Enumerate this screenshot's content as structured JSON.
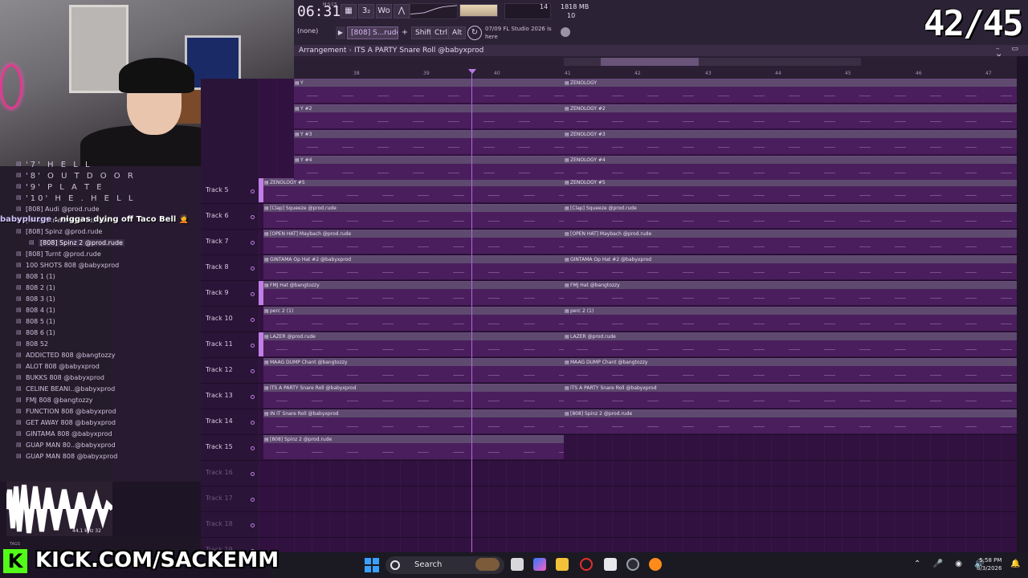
{
  "toolbar": {
    "time": "06:31",
    "time_sub": "M:S:CS",
    "buttons": [
      "▦",
      "3₂",
      "Wo",
      "⋀"
    ],
    "cpu": "14",
    "ram": "1818 MB",
    "polyphony": "10",
    "pattern": "(none)",
    "sample": "[808] S...rude",
    "plus": "+",
    "keys": [
      "Shift",
      "Ctrl",
      "Alt"
    ],
    "news_line1": "07/09  FL Studio 2026 is",
    "news_line2": "here",
    "counter": "42/45"
  },
  "arrangement": {
    "breadcrumb_a": "Arrangement",
    "breadcrumb_sep": "›",
    "breadcrumb_b": "ITS A PARTY Snare Roll @babyxprod",
    "window_controls": "– ▭ ✕",
    "bar_numbers": [
      "38",
      "39",
      "40",
      "41",
      "42",
      "43",
      "44",
      "45",
      "46",
      "47"
    ],
    "upper_clips": [
      "Y",
      "ZENOLOGY",
      "Y #2",
      "ZENOLOGY #2",
      "Y #3",
      "ZENOLOGY #3",
      "Y #4",
      "ZENOLOGY #4"
    ],
    "tracks": [
      {
        "name": "Track 5",
        "clip_a": "ZENOLOGY #5",
        "clip_b": "ZENOLOGY #5"
      },
      {
        "name": "Track 6",
        "clip_a": "[Clap] Squeeze @prod.rude",
        "clip_b": "[Clap] Squeeze @prod.rude"
      },
      {
        "name": "Track 7",
        "clip_a": "[OPEN HAT] Maybach @prod.rude",
        "clip_b": "[OPEN HAT] Maybach @prod.rude"
      },
      {
        "name": "Track 8",
        "clip_a": "GINTAMA Op Hat #2 @babyxprod",
        "clip_b": "GINTAMA Op Hat #2 @babyxprod"
      },
      {
        "name": "Track 9",
        "clip_a": "FMJ Hat @bangtozzy",
        "clip_b": "FMJ Hat @bangtozzy"
      },
      {
        "name": "Track 10",
        "clip_a": "perc 2 (1)",
        "clip_b": "perc 2 (1)"
      },
      {
        "name": "Track 11",
        "clip_a": "LAZER @prod.rude",
        "clip_b": "LAZER @prod.rude"
      },
      {
        "name": "Track 12",
        "clip_a": "MAAG DUMP Chant @bangtozzy",
        "clip_b": "MAAG DUMP Chant @bangtozzy"
      },
      {
        "name": "Track 13",
        "clip_a": "ITS A PARTY Snare Roll @babyxprod",
        "clip_b": "ITS A PARTY Snare Roll @babyxprod"
      },
      {
        "name": "Track 14",
        "clip_a": "IN IT Snare Roll @babyxprod",
        "clip_b": "[808] Spinz 2 @prod.rude"
      },
      {
        "name": "Track 15",
        "clip_a": "[808] Spinz 2 @prod.rude",
        "clip_b": ""
      },
      {
        "name": "Track 16",
        "clip_a": "",
        "clip_b": ""
      },
      {
        "name": "Track 17",
        "clip_a": "",
        "clip_b": ""
      },
      {
        "name": "Track 18",
        "clip_a": "",
        "clip_b": ""
      },
      {
        "name": "Track 19",
        "clip_a": "",
        "clip_b": ""
      }
    ]
  },
  "browser": {
    "items": [
      {
        "label": "'7' H E L L",
        "style": "spaced"
      },
      {
        "label": "'8' O U T D O O R",
        "style": "spaced"
      },
      {
        "label": "'9' P L A T E",
        "style": "spaced"
      },
      {
        "label": "'10' H E . H E L L",
        "style": "spaced"
      },
      {
        "label": "[808] Audi @prod.rude",
        "style": ""
      },
      {
        "label": "[808] Scratch @prod.rude",
        "style": ""
      },
      {
        "label": "[808] Spinz @prod.rude",
        "style": ""
      },
      {
        "label": "[808] Spinz 2 @prod.rude",
        "style": "sel"
      },
      {
        "label": "[808] Turnt @prod.rude",
        "style": ""
      },
      {
        "label": "100 SHOTS 808 @babyxprod",
        "style": ""
      },
      {
        "label": "808 1 (1)",
        "style": ""
      },
      {
        "label": "808 2 (1)",
        "style": ""
      },
      {
        "label": "808 3 (1)",
        "style": ""
      },
      {
        "label": "808 4 (1)",
        "style": ""
      },
      {
        "label": "808 5 (1)",
        "style": ""
      },
      {
        "label": "808 6 (1)",
        "style": ""
      },
      {
        "label": "808 52",
        "style": ""
      },
      {
        "label": "ADDICTED 808 @bangtozzy",
        "style": ""
      },
      {
        "label": "ALOT 808 @babyxprod",
        "style": ""
      },
      {
        "label": "BUKKS 808 @babyxprod",
        "style": ""
      },
      {
        "label": "CELINE BEANI..@babyxprod",
        "style": ""
      },
      {
        "label": "FMJ 808 @bangtozzy",
        "style": ""
      },
      {
        "label": "FUNCTION 808 @babyxprod",
        "style": ""
      },
      {
        "label": "GET AWAY 808 @babyxprod",
        "style": ""
      },
      {
        "label": "GINTAMA 808 @babyxprod",
        "style": ""
      },
      {
        "label": "GUAP MAN 80..@babyxprod",
        "style": ""
      },
      {
        "label": "GUAP MAN 808 @babyxprod",
        "style": ""
      }
    ],
    "wave_info": "44.1 kHz 32",
    "tags": "TAGS"
  },
  "chat": {
    "user": "babyplurge",
    "sep": " : ",
    "message": "niggas dying off Taco Bell 🤦"
  },
  "overlay": {
    "kick_logo": "K",
    "kick_text": "KICK.COM/SACKEMM"
  },
  "taskbar": {
    "search_label": "Search",
    "tray": "⌃ 🎤 ◉ 🔊",
    "time": "5:58 PM",
    "date": "8/3/2026",
    "notif": "🔔"
  },
  "colors": {
    "accent": "#c07ee6",
    "kick_green": "#53fc18",
    "clip_body": "#4a1e5c",
    "clip_header": "#5e4a6e"
  }
}
